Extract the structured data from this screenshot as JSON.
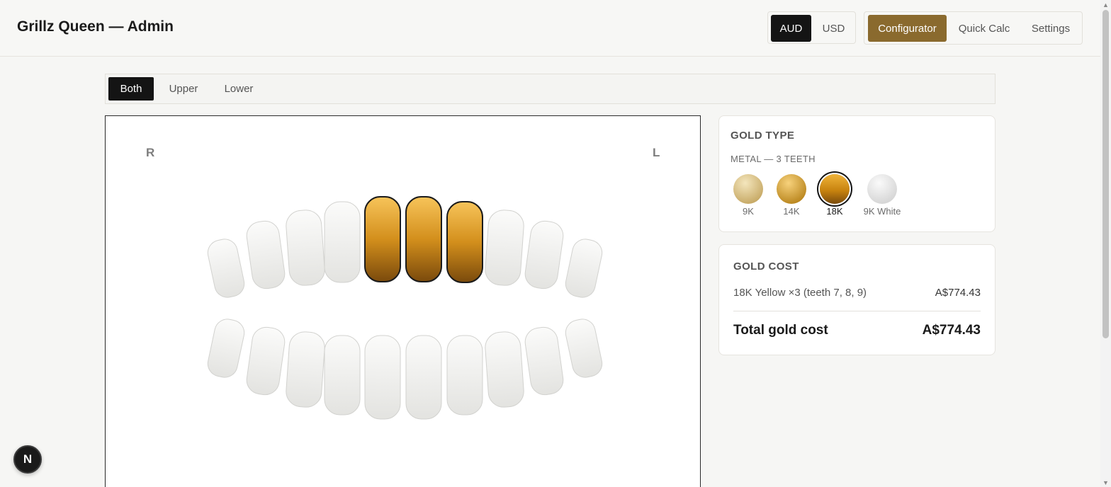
{
  "header": {
    "title": "Grillz Queen — Admin",
    "currency": {
      "options": [
        "AUD",
        "USD"
      ],
      "selected": "AUD"
    },
    "nav": {
      "items": [
        "Configurator",
        "Quick Calc",
        "Settings"
      ],
      "active": "Configurator"
    }
  },
  "arch_tabs": {
    "items": [
      "Both",
      "Upper",
      "Lower"
    ],
    "active": "Both"
  },
  "mouth_view": {
    "right_label": "R",
    "left_label": "L",
    "selected_teeth": [
      7,
      8,
      9
    ],
    "selected_metal_color": "#d89a26"
  },
  "gold_type": {
    "title": "GOLD TYPE",
    "subtitle": "METAL — 3 TEETH",
    "options": [
      {
        "label": "9K",
        "color": "#d8c28c",
        "selected": false
      },
      {
        "label": "14K",
        "color": "#d9a43c",
        "selected": false
      },
      {
        "label": "18K",
        "color": "#c98512",
        "selected": true
      },
      {
        "label": "9K White",
        "color": "#e2e2e2",
        "selected": false
      }
    ]
  },
  "gold_cost": {
    "title": "GOLD COST",
    "line_item": {
      "label": "18K Yellow ×3 (teeth 7, 8, 9)",
      "value": "A$774.43"
    },
    "total_label": "Total gold cost",
    "total_value": "A$774.43"
  },
  "dev_badge": {
    "glyph": "N"
  }
}
